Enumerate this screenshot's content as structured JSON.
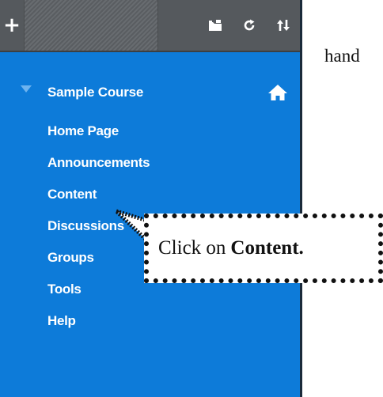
{
  "toolbar": {
    "icons": [
      "plus-icon",
      "folder-icon",
      "refresh-icon",
      "sort-icon"
    ]
  },
  "course": {
    "title": "Sample Course",
    "icon": "home-icon"
  },
  "menu": {
    "items": [
      {
        "label": "Home Page"
      },
      {
        "label": "Announcements"
      },
      {
        "label": "Content"
      },
      {
        "label": "Discussions"
      },
      {
        "label": "Groups"
      },
      {
        "label": "Tools"
      },
      {
        "label": "Help"
      }
    ]
  },
  "document": {
    "visible_word": "hand"
  },
  "callout": {
    "prefix": "Click on",
    "emphasis": "Content."
  },
  "colors": {
    "menu_background": "#0d7bd9",
    "toolbar_background": "#55595d",
    "menu_text": "#ffffff",
    "collapse_arrow": "#6db3ef"
  }
}
